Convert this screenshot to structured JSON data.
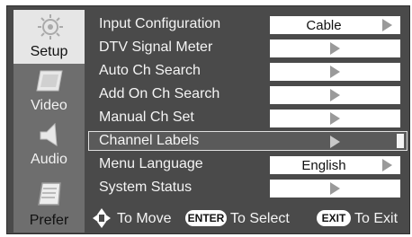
{
  "sidebar": {
    "items": [
      {
        "label": "Setup",
        "icon": "gear-icon"
      },
      {
        "label": "Video",
        "icon": "screen-icon"
      },
      {
        "label": "Audio",
        "icon": "speaker-icon"
      },
      {
        "label": "Prefer",
        "icon": "notepad-icon"
      }
    ]
  },
  "menu": {
    "rows": [
      {
        "label": "Input Configuration",
        "value": "Cable"
      },
      {
        "label": "DTV Signal Meter",
        "value": ""
      },
      {
        "label": "Auto Ch Search",
        "value": ""
      },
      {
        "label": "Add On Ch Search",
        "value": ""
      },
      {
        "label": "Manual Ch Set",
        "value": ""
      },
      {
        "label": "Channel Labels",
        "value": ""
      },
      {
        "label": "Menu Language",
        "value": "English"
      },
      {
        "label": "System Status",
        "value": ""
      }
    ],
    "selected_index": 5
  },
  "footer": {
    "move_label": "To Move",
    "enter_key": "ENTER",
    "select_label": "To Select",
    "exit_key": "EXIT",
    "exit_label": "To Exit"
  },
  "colors": {
    "background": "#4a4a4a",
    "active_tab": "#e6e6e6",
    "inactive_tab": "#6e6e6e",
    "value_box": "#ffffff",
    "text": "#f4f4f4"
  }
}
